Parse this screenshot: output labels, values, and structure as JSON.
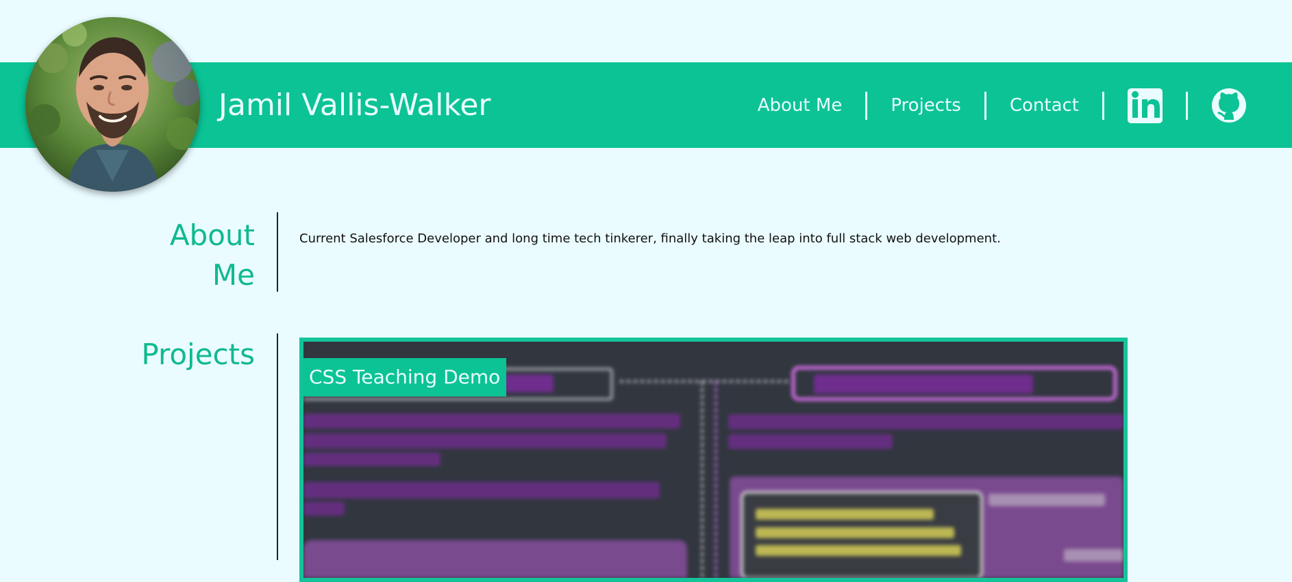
{
  "header": {
    "name": "Jamil Vallis-Walker",
    "nav": [
      "About Me",
      "Projects",
      "Contact"
    ],
    "social": {
      "linkedin": "linkedin-icon",
      "github": "github-icon"
    }
  },
  "about": {
    "title": "About Me",
    "text": "Current Salesforce Developer and long time tech tinkerer, finally taking the leap into full stack web development."
  },
  "projects": {
    "title": "Projects",
    "items": [
      {
        "title": "CSS Teaching Demo"
      }
    ]
  }
}
